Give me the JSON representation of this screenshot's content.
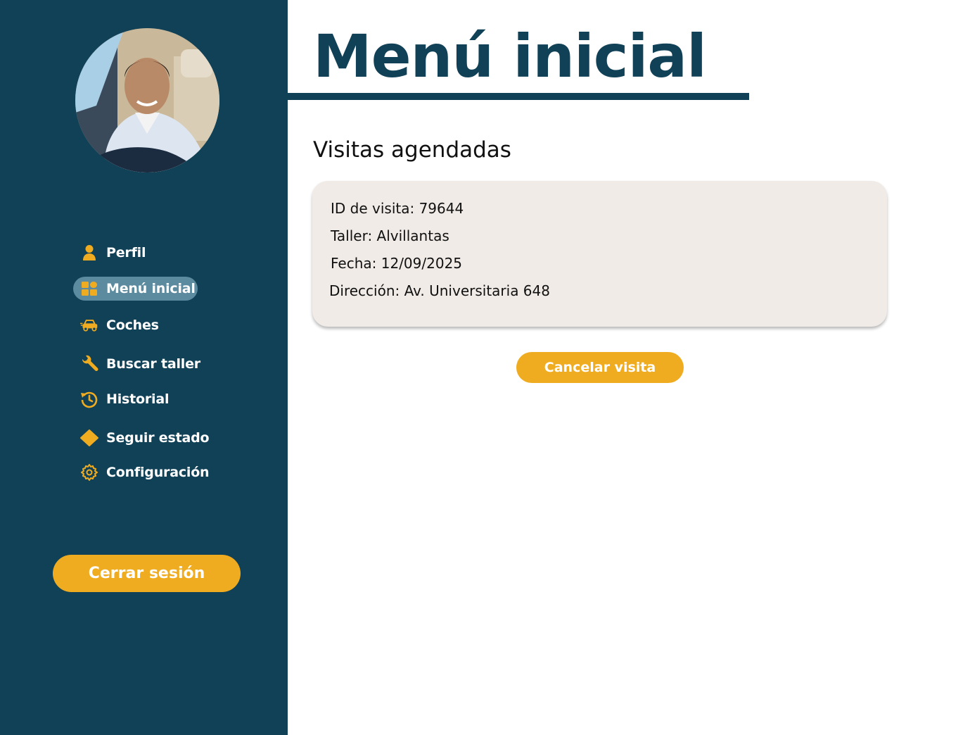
{
  "sidebar": {
    "items": [
      {
        "label": "Perfil",
        "icon": "user-icon"
      },
      {
        "label": "Menú inicial",
        "icon": "dashboard-icon",
        "active": true
      },
      {
        "label": "Coches",
        "icon": "car-icon"
      },
      {
        "label": "Buscar taller",
        "icon": "wrench-icon"
      },
      {
        "label": "Historial",
        "icon": "history-icon"
      },
      {
        "label": "Seguir estado",
        "icon": "diamond-icon"
      },
      {
        "label": "Configuración",
        "icon": "gear-icon"
      }
    ],
    "logout_label": "Cerrar sesión"
  },
  "main": {
    "title": "Menú inicial",
    "section_heading": "Visitas agendadas",
    "visit": {
      "id_line": "ID de visita: 79644",
      "workshop_line": "Taller: Alvillantas",
      "date_line": "Fecha: 12/09/2025",
      "address_line": "Dirección: Av. Universitaria 648"
    },
    "cancel_label": "Cancelar visita"
  },
  "colors": {
    "sidebar_bg": "#114157",
    "accent": "#f0ac20",
    "active_item_bg": "#5c8a9f",
    "card_bg": "#f0ebe7",
    "title": "#114157"
  }
}
